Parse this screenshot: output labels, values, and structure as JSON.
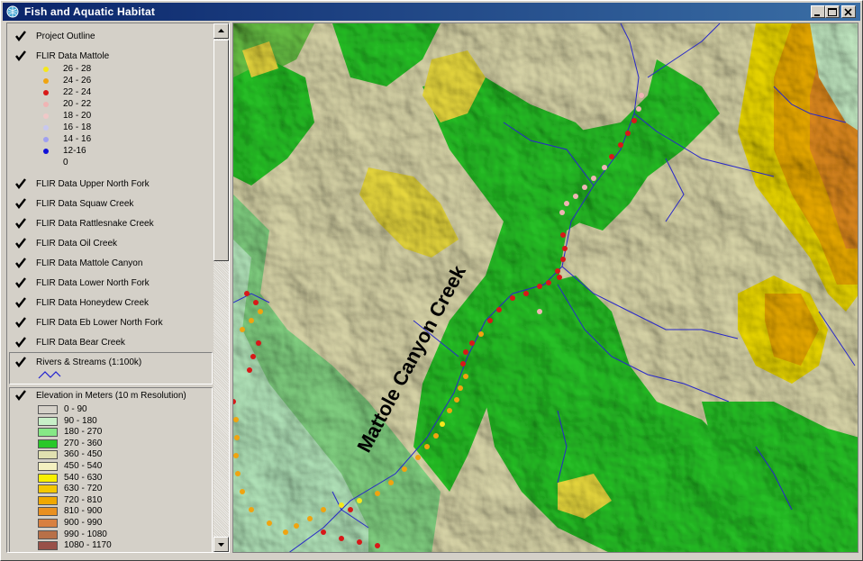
{
  "window": {
    "title": "Fish and Aquatic Habitat"
  },
  "toc": {
    "layers": [
      {
        "label": "Project Outline",
        "checked": true
      },
      {
        "label": "FLIR Data Mattole",
        "checked": true
      },
      {
        "label": "FLIR Data Upper North Fork",
        "checked": true
      },
      {
        "label": "FLIR Data Squaw Creek",
        "checked": true
      },
      {
        "label": "FLIR Data Rattlesnake Creek",
        "checked": true
      },
      {
        "label": "FLIR Data Oil Creek",
        "checked": true
      },
      {
        "label": "FLIR Data Mattole Canyon",
        "checked": true
      },
      {
        "label": "FLIR Data Lower North Fork",
        "checked": true
      },
      {
        "label": "FLIR Data Honeydew Creek",
        "checked": true
      },
      {
        "label": "FLIR Data Eb Lower North Fork",
        "checked": true
      },
      {
        "label": "FLIR Data Bear Creek",
        "checked": true
      },
      {
        "label": "Rivers & Streams (1:100k)",
        "checked": true
      },
      {
        "label": "Elevation in Meters (10 m Resolution)",
        "checked": true
      }
    ],
    "flir_legend": [
      {
        "label": "26 - 28",
        "color": "#f5e81c"
      },
      {
        "label": "24 - 26",
        "color": "#f0a410"
      },
      {
        "label": "22 - 24",
        "color": "#d81818"
      },
      {
        "label": "20 - 22",
        "color": "#f0b4b4"
      },
      {
        "label": "18 - 20",
        "color": "#f0c8c8"
      },
      {
        "label": "16 - 18",
        "color": "#c8c8f0"
      },
      {
        "label": "14 - 16",
        "color": "#a0a0f0"
      },
      {
        "label": "12-16",
        "color": "#1010d8"
      },
      {
        "label": "0",
        "color": ""
      }
    ],
    "elevation_legend": [
      {
        "label": "0 - 90",
        "color": "#d4d0c8"
      },
      {
        "label": "90 - 180",
        "color": "#c8f0c8"
      },
      {
        "label": "180 - 270",
        "color": "#86e886"
      },
      {
        "label": "270 - 360",
        "color": "#28c828"
      },
      {
        "label": "360 - 450",
        "color": "#e0e0b0"
      },
      {
        "label": "450 - 540",
        "color": "#f4f0c0"
      },
      {
        "label": "540 - 630",
        "color": "#f8f000"
      },
      {
        "label": "630 - 720",
        "color": "#f4c800"
      },
      {
        "label": "720 - 810",
        "color": "#f0a800"
      },
      {
        "label": "810 - 900",
        "color": "#e89020"
      },
      {
        "label": "900 - 990",
        "color": "#d88040"
      },
      {
        "label": "990 - 1080",
        "color": "#b87048"
      },
      {
        "label": "1080 - 1170",
        "color": "#985048"
      }
    ]
  },
  "map": {
    "label": "Mattole Canyon Creek"
  }
}
